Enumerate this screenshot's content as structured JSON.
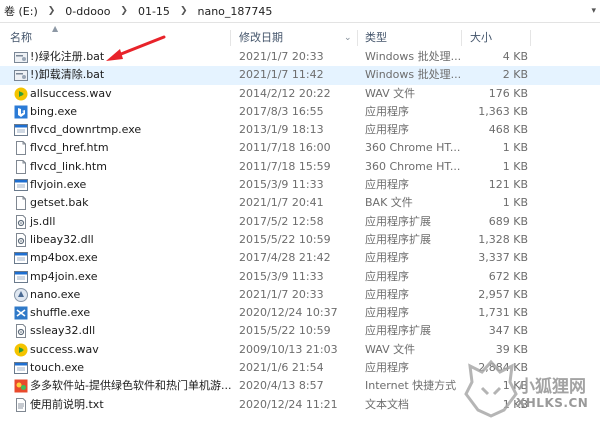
{
  "breadcrumb": [
    "卷 (E:)",
    "0-ddooo",
    "01-15",
    "nano_187745"
  ],
  "columns": {
    "name": "名称",
    "date": "修改日期",
    "type": "类型",
    "size": "大小"
  },
  "files": [
    {
      "name": "!)绿化注册.bat",
      "date": "2021/1/7 20:33",
      "type": "Windows 批处理...",
      "size": "4 KB",
      "icon": "batch-file-icon"
    },
    {
      "name": "!)卸载清除.bat",
      "date": "2021/1/7 11:42",
      "type": "Windows 批处理...",
      "size": "2 KB",
      "icon": "batch-file-icon"
    },
    {
      "name": "allsuccess.wav",
      "date": "2014/2/12 20:22",
      "type": "WAV 文件",
      "size": "176 KB",
      "icon": "audio-file-icon"
    },
    {
      "name": "bing.exe",
      "date": "2017/8/3 16:55",
      "type": "应用程序",
      "size": "1,363 KB",
      "icon": "bing-app-icon"
    },
    {
      "name": "flvcd_downrtmp.exe",
      "date": "2013/1/9 18:13",
      "type": "应用程序",
      "size": "468 KB",
      "icon": "application-icon"
    },
    {
      "name": "flvcd_href.htm",
      "date": "2011/7/18 16:00",
      "type": "360 Chrome HT...",
      "size": "1 KB",
      "icon": "document-icon"
    },
    {
      "name": "flvcd_link.htm",
      "date": "2011/7/18 15:59",
      "type": "360 Chrome HT...",
      "size": "1 KB",
      "icon": "document-icon"
    },
    {
      "name": "flvjoin.exe",
      "date": "2015/3/9 11:33",
      "type": "应用程序",
      "size": "121 KB",
      "icon": "application-icon"
    },
    {
      "name": "getset.bak",
      "date": "2021/1/7 20:41",
      "type": "BAK 文件",
      "size": "1 KB",
      "icon": "document-icon"
    },
    {
      "name": "js.dll",
      "date": "2017/5/2 12:58",
      "type": "应用程序扩展",
      "size": "689 KB",
      "icon": "dll-file-icon"
    },
    {
      "name": "libeay32.dll",
      "date": "2015/5/22 10:59",
      "type": "应用程序扩展",
      "size": "1,328 KB",
      "icon": "dll-file-icon"
    },
    {
      "name": "mp4box.exe",
      "date": "2017/4/28 21:42",
      "type": "应用程序",
      "size": "3,337 KB",
      "icon": "application-icon"
    },
    {
      "name": "mp4join.exe",
      "date": "2015/3/9 11:33",
      "type": "应用程序",
      "size": "672 KB",
      "icon": "application-icon"
    },
    {
      "name": "nano.exe",
      "date": "2021/1/7 20:33",
      "type": "应用程序",
      "size": "2,957 KB",
      "icon": "nano-app-icon"
    },
    {
      "name": "shuffle.exe",
      "date": "2020/12/24 10:37",
      "type": "应用程序",
      "size": "1,731 KB",
      "icon": "shuffle-app-icon"
    },
    {
      "name": "ssleay32.dll",
      "date": "2015/5/22 10:59",
      "type": "应用程序扩展",
      "size": "347 KB",
      "icon": "dll-file-icon"
    },
    {
      "name": "success.wav",
      "date": "2009/10/13 21:03",
      "type": "WAV 文件",
      "size": "39 KB",
      "icon": "audio-file-icon"
    },
    {
      "name": "touch.exe",
      "date": "2021/1/6 21:54",
      "type": "应用程序",
      "size": "2,884 KB",
      "icon": "application-icon"
    },
    {
      "name": "多多软件站-提供绿色软件和热门单机游...",
      "date": "2020/4/13 8:57",
      "type": "Internet 快捷方式",
      "size": "1 KB",
      "icon": "internet-shortcut-icon"
    },
    {
      "name": "使用前说明.txt",
      "date": "2020/12/24 11:21",
      "type": "文本文档",
      "size": "1 KB",
      "icon": "text-file-icon"
    }
  ],
  "selected_row": 1,
  "watermark": {
    "brand": "小狐狸网",
    "url": "XHLKS.CN"
  },
  "colors": {
    "highlight": "#e5f3ff",
    "arrow": "#e8232a",
    "audio": "#f4c400",
    "app_blue": "#1e6fd1"
  }
}
